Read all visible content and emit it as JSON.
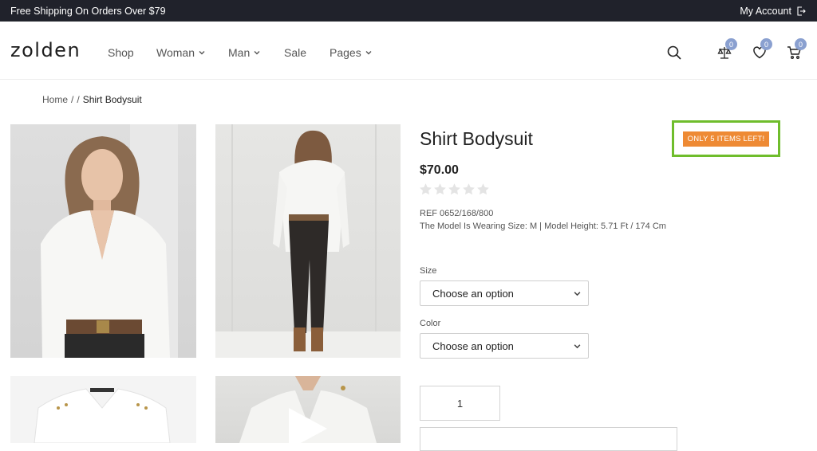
{
  "topbar": {
    "shipping_text": "Free Shipping On Orders Over $79",
    "account_label": "My Account"
  },
  "header": {
    "logo": "zolden",
    "nav": [
      {
        "label": "Shop",
        "dropdown": false
      },
      {
        "label": "Woman",
        "dropdown": true
      },
      {
        "label": "Man",
        "dropdown": true
      },
      {
        "label": "Sale",
        "dropdown": false
      },
      {
        "label": "Pages",
        "dropdown": true
      }
    ],
    "icons": {
      "search": "search-icon",
      "compare": {
        "icon": "compare-scale-icon",
        "count": "0"
      },
      "wishlist": {
        "icon": "heart-icon",
        "count": "0"
      },
      "cart": {
        "icon": "cart-icon",
        "count": "0"
      }
    }
  },
  "breadcrumb": {
    "home": "Home",
    "sep1": "/",
    "sep2": "/",
    "current": "Shirt Bodysuit"
  },
  "product": {
    "title": "Shirt Bodysuit",
    "stock_badge": "ONLY 5 ITEMS LEFT!",
    "price": "$70.00",
    "rating": 0,
    "rating_max": 5,
    "ref": "REF 0652/168/800",
    "model_info": "The Model Is Wearing Size: M | Model Height: 5.71 Ft / 174 Cm",
    "size_label": "Size",
    "size_value": "Choose an option",
    "color_label": "Color",
    "color_value": "Choose an option",
    "quantity": "1"
  },
  "colors": {
    "topbar_bg": "#20222b",
    "badge_bg": "#ee8a34",
    "highlight_border": "#6fbd2c",
    "count_badge": "#8aa0d0"
  }
}
